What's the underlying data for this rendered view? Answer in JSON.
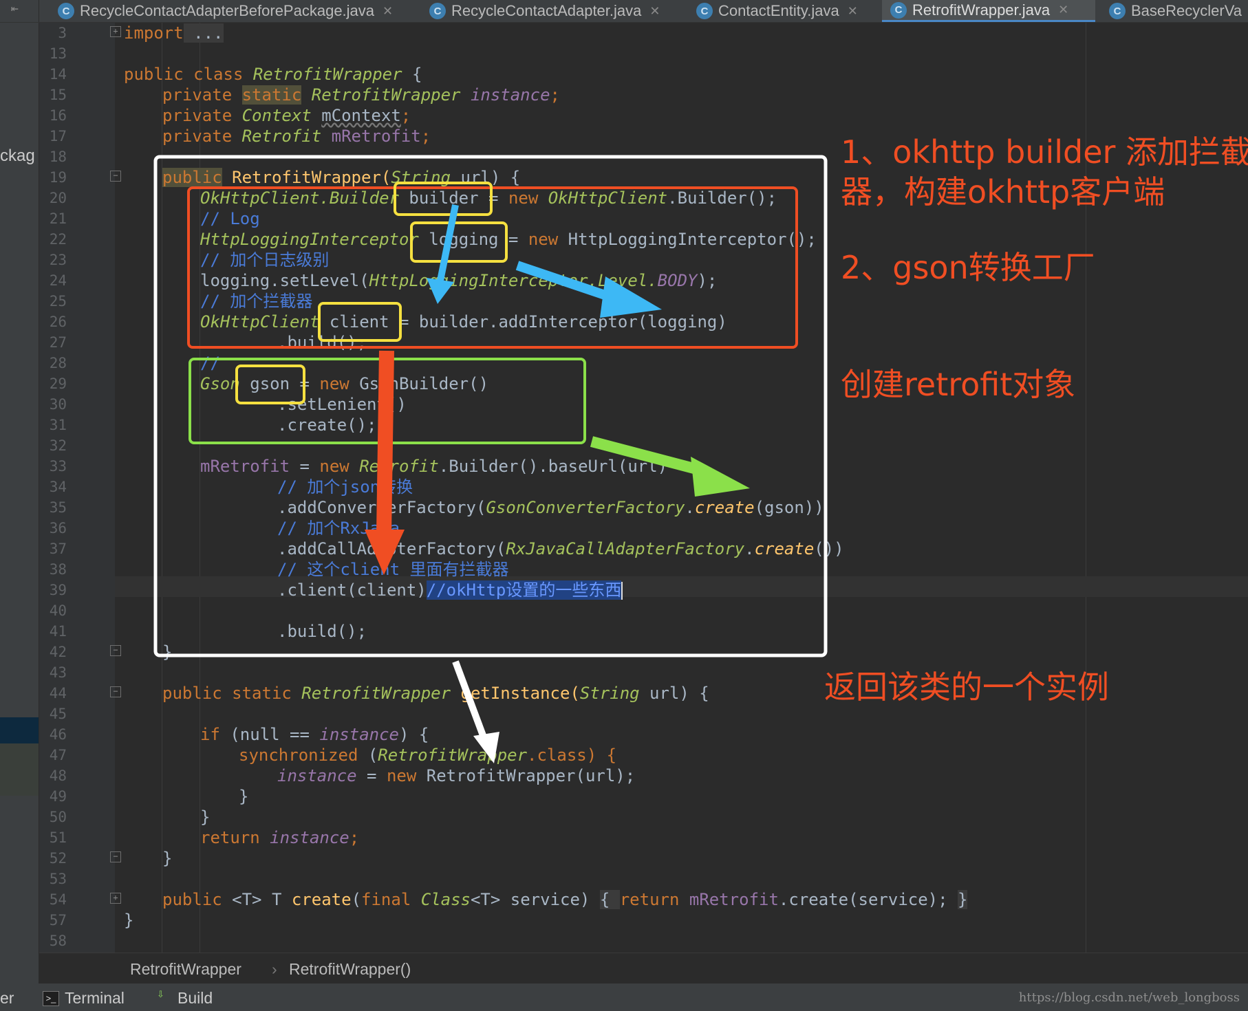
{
  "tabs": [
    {
      "label": "RecycleContactAdapterBeforePackage.java",
      "active": false
    },
    {
      "label": "RecycleContactAdapter.java",
      "active": false
    },
    {
      "label": "ContactEntity.java",
      "active": false
    },
    {
      "label": "RetrofitWrapper.java",
      "active": true
    },
    {
      "label": "BaseRecyclerVa",
      "active": false
    }
  ],
  "left_panel": {
    "package_label": "ckag"
  },
  "line_numbers": [
    "3",
    "13",
    "14",
    "15",
    "16",
    "17",
    "18",
    "19",
    "20",
    "21",
    "22",
    "23",
    "24",
    "25",
    "26",
    "27",
    "28",
    "29",
    "30",
    "31",
    "32",
    "33",
    "34",
    "35",
    "36",
    "37",
    "38",
    "39",
    "40",
    "41",
    "42",
    "43",
    "44",
    "45",
    "46",
    "47",
    "48",
    "49",
    "50",
    "51",
    "52",
    "53",
    "54",
    "57",
    "58"
  ],
  "code": {
    "l3": [
      "import",
      " ..."
    ],
    "l14": [
      "public class ",
      "RetrofitWrapper",
      " {"
    ],
    "l15": [
      "private ",
      "static",
      " RetrofitWrapper ",
      "instance",
      ";"
    ],
    "l16": [
      "private ",
      "Context ",
      "mContext",
      ";"
    ],
    "l17": [
      "private ",
      "Retrofit ",
      "mRetrofit",
      ";"
    ],
    "l19": [
      "public",
      " RetrofitWrapper(",
      "String",
      " url) {"
    ],
    "l20": [
      "OkHttpClient.Builder",
      " builder ",
      "= ",
      "new ",
      "OkHttpClient",
      ".Builder();"
    ],
    "l21": [
      "// Log"
    ],
    "l22": [
      "HttpLoggingInterceptor",
      " logging = ",
      "new ",
      "HttpLoggingInterceptor();"
    ],
    "l23": [
      "// 加个日志级别"
    ],
    "l24": [
      "logging.setLevel(",
      "HttpLoggingInterceptor.Level.",
      "BODY",
      ");"
    ],
    "l25": [
      "// 加个拦截器"
    ],
    "l26": [
      "OkHttpClient",
      " client = builder.addInterceptor(logging)"
    ],
    "l27": [
      ".build();"
    ],
    "l28": [
      "//"
    ],
    "l29": [
      "Gson",
      " gson = ",
      "new ",
      "GsonBuilder()"
    ],
    "l30": [
      ".setLenient()"
    ],
    "l31": [
      ".create();"
    ],
    "l33": [
      "mRetrofit",
      " = ",
      "new ",
      "Retrofit",
      ".Builder().baseUrl(url)"
    ],
    "l34": [
      "// 加个json转换"
    ],
    "l35": [
      ".addConverterFactory(",
      "GsonConverterFactory",
      ".",
      "create",
      "(gson))"
    ],
    "l36": [
      "// 加个RxJava"
    ],
    "l37": [
      ".addCallAdapterFactory(",
      "RxJavaCallAdapterFactory",
      ".",
      "create",
      "())"
    ],
    "l38": [
      "// 这个client 里面有拦截器"
    ],
    "l39": [
      ".client(client)",
      "//okHttp设置的一些东西"
    ],
    "l41": [
      ".build();"
    ],
    "l42": [
      "}"
    ],
    "l44": [
      "public static ",
      "RetrofitWrapper",
      " getInstance(",
      "String",
      " url) {"
    ],
    "l46": [
      "if ",
      "(null == ",
      "instance",
      ") {"
    ],
    "l47": [
      "synchronized ",
      "(",
      "RetrofitWrapper",
      ".class) {"
    ],
    "l48": [
      "instance",
      " = ",
      "new ",
      "RetrofitWrapper(url);"
    ],
    "l49": [
      "}"
    ],
    "l50": [
      "}"
    ],
    "l51": [
      "return ",
      "instance",
      ";"
    ],
    "l52": [
      "}"
    ],
    "l54": [
      "public ",
      "<T> T ",
      "create",
      "(",
      "final ",
      "Class",
      "<T> service) ",
      "{ ",
      "return ",
      "mRetrofit",
      ".create(service); ",
      "}"
    ],
    "l57": [
      "}"
    ]
  },
  "annotations": {
    "a1_line1": "1、okhttp builder 添加拦截",
    "a1_line2": "器，构建okhttp客户端",
    "a2": "2、gson转换工厂",
    "a3": "创建retrofit对象",
    "a4": "返回该类的一个实例"
  },
  "breadcrumb": [
    "RetrofitWrapper",
    "RetrofitWrapper()"
  ],
  "bottom_bar": {
    "left_stub": "er",
    "terminal": "Terminal",
    "build": "Build",
    "watermark": "https://blog.csdn.net/web_longboss"
  },
  "colors": {
    "annotation_red": "#f04e23",
    "box_white": "#ffffff",
    "box_orange": "#f04e23",
    "box_green": "#8be04a",
    "box_yellow": "#f5e040",
    "arrow_blue": "#3db8f5",
    "arrow_red": "#f04e23",
    "arrow_green": "#8be04a",
    "arrow_white": "#ffffff"
  }
}
